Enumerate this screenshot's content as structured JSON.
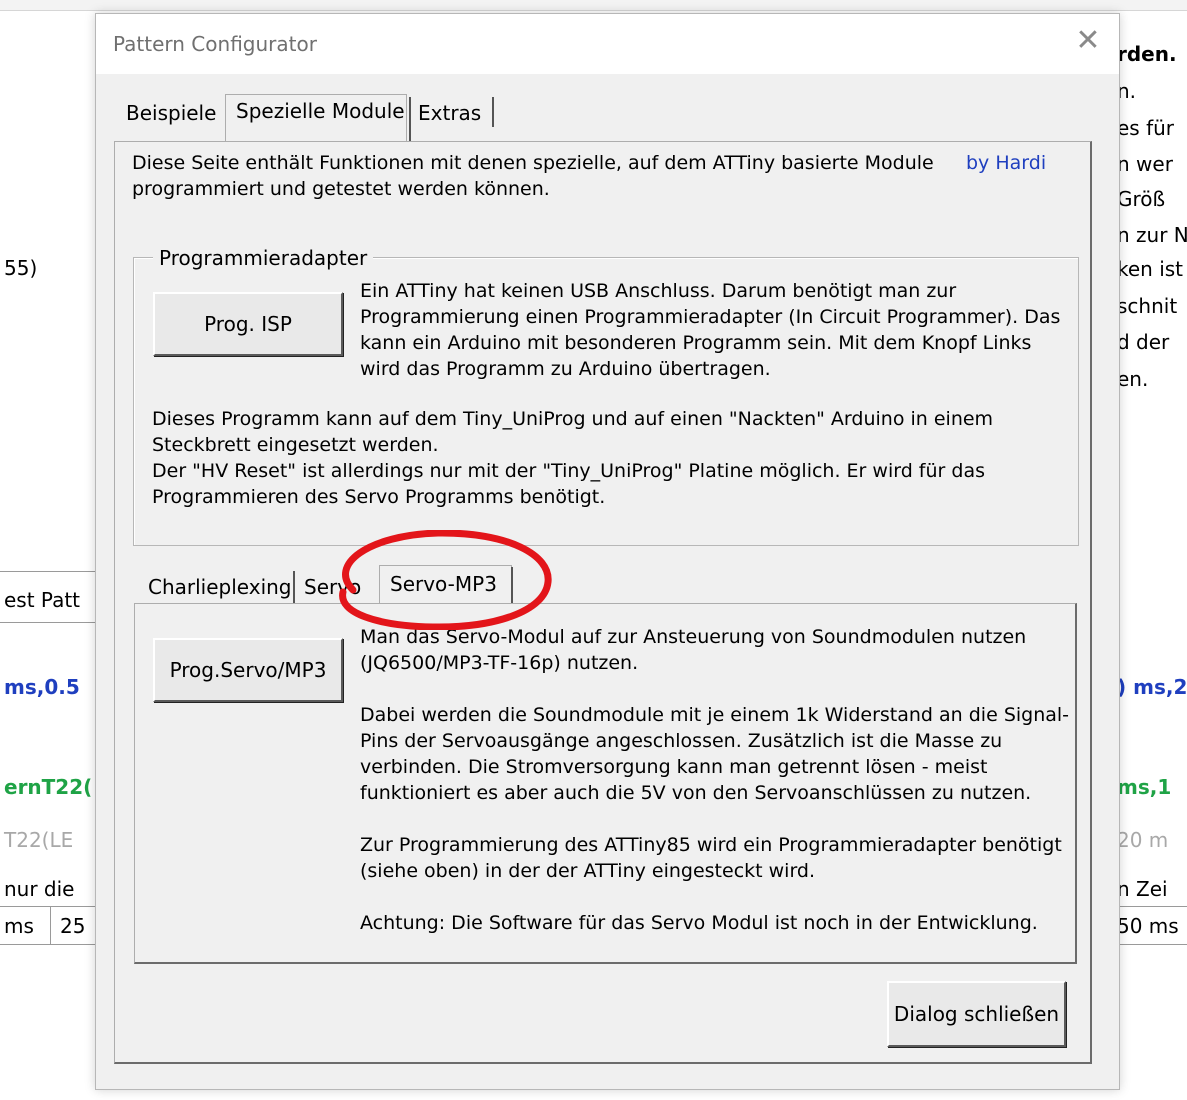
{
  "background_doc": {
    "right_lines": [
      "rden.",
      "n.",
      "es für",
      "n wer",
      "Größ",
      "n zur N",
      "ken ist",
      "schnit",
      "d der",
      "en."
    ],
    "left_text_55": "55)",
    "left_est_patt": "est Patt",
    "left_ms_05": "ms,0.5",
    "right_ms_2": ") ms,2",
    "left_ernT22": "ernT22(",
    "right_ms_1": "ms,1",
    "left_T22LE": "T22(LE",
    "right_20m": "20 m",
    "left_nur_die": "nur die",
    "right_n_zei": "n Zei",
    "table_left_1": "ms",
    "table_left_2": "25",
    "table_right": "50 ms"
  },
  "dialog": {
    "title": "Pattern Configurator",
    "close_glyph": "✕",
    "tabs": [
      "Beispiele",
      "Spezielle Module",
      "Extras"
    ],
    "selected_tab": "Spezielle Module",
    "intro_line1": "Diese Seite enthält Funktionen mit denen spezielle, auf dem ATTiny basierte Module",
    "intro_line2": "programmiert und getestet werden können.",
    "by_link": "by Hardi",
    "group": {
      "label": "Programmieradapter",
      "button": "Prog. ISP",
      "desc": [
        "Ein ATTiny hat keinen USB Anschluss. Darum benötigt man zur",
        "Programmierung einen Programmieradapter (In Circuit Programmer). Das",
        "kann ein Arduino mit besonderen Programm sein. Mit dem Knopf Links",
        "wird das Programm zu Arduino übertragen."
      ],
      "note": [
        "Dieses Programm kann auf dem Tiny_UniProg und auf einen \"Nackten\" Arduino in einem",
        "Steckbrett eingesetzt werden.",
        "Der \"HV Reset\" ist allerdings nur mit der \"Tiny_UniProg\" Platine möglich. Er wird für das",
        "Programmieren des Servo Programms benötigt."
      ]
    },
    "subtabs": [
      "Charlieplexing",
      "Servo",
      "Servo-MP3"
    ],
    "selected_subtab": "Servo-MP3",
    "sub": {
      "button": "Prog.Servo/MP3",
      "lines": [
        "Man das Servo-Modul auf zur Ansteuerung von Soundmodulen nutzen",
        "(JQ6500/MP3-TF-16p) nutzen.",
        "Dabei werden die Soundmodule mit je einem 1k Widerstand an die Signal-",
        "Pins der Servoausgänge angeschlossen. Zusätzlich ist die Masse zu",
        "verbinden. Die Stromversorgung kann man getrennt lösen - meist",
        "funktioniert es aber auch die 5V von den Servoanschlüssen zu nutzen.",
        "Zur Programmierung des ATTiny85 wird ein Programmieradapter benötigt",
        "(siehe oben) in der der ATTiny eingesteckt wird.",
        "Achtung: Die Software für das Servo Modul ist noch in der Entwicklung."
      ]
    },
    "close_button": "Dialog schließen"
  },
  "colors": {
    "annotation": "#e3151a",
    "link": "#1f3fbf"
  }
}
